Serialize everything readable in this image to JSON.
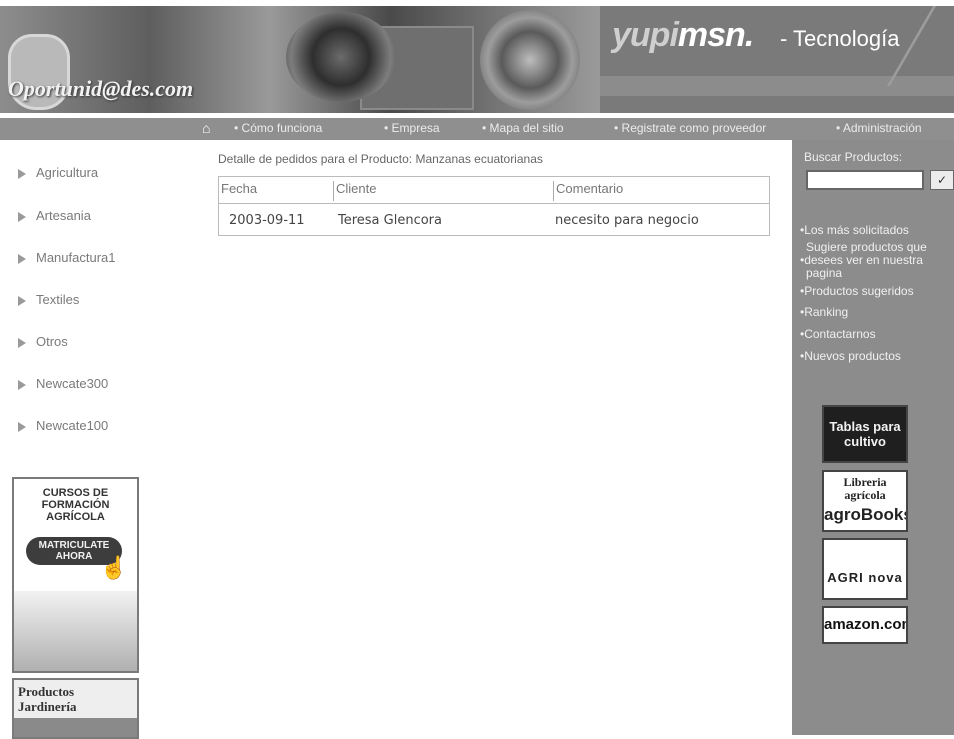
{
  "header": {
    "logo_text": "Oportunid@des.com",
    "msn_brand_light": "yupi",
    "msn_brand_bold": "msn.",
    "msn_suffix": "- Tecnología"
  },
  "nav": {
    "items": [
      "• Cómo funciona",
      "• Empresa",
      "• Mapa del sitio",
      "• Registrate como proveedor",
      "• Administración"
    ]
  },
  "sidebar": {
    "categories": [
      "Agricultura",
      "Artesania",
      "Manufactura1",
      "Textiles",
      "Otros",
      "Newcate300",
      "Newcate100"
    ],
    "ad_cursos": {
      "title": "CURSOS DE FORMACIÓN AGRÍCOLA",
      "button": "MATRICULATE AHORA"
    },
    "ad_productos": {
      "line1": "Productos",
      "line2": "Jardinería"
    }
  },
  "main": {
    "title": "Detalle de pedidos para el Producto: Manzanas ecuatorianas",
    "columns": [
      "Fecha",
      "Cliente",
      "Comentario"
    ],
    "rows": [
      {
        "fecha": "2003-09-11",
        "cliente": "Teresa Glencora",
        "comentario": "necesito para negocio"
      }
    ]
  },
  "right": {
    "search_label": "Buscar Productos:",
    "search_value": "",
    "search_button": "✓",
    "links": {
      "mas_solicitados": "•Los más solicitados",
      "sugiere_1": "Sugiere productos que",
      "sugiere_2": "•desees ver en nuestra",
      "sugiere_3": "pagina",
      "sugeridos": "•Productos sugeridos",
      "ranking": "•Ranking",
      "contactarnos": "•Contactarnos",
      "nuevos": "•Nuevos productos"
    },
    "logos": {
      "tablas": "Tablas para cultivo",
      "libreria": "Libreria agrícola",
      "libreria_sub": "agroBooks",
      "agrinova": "AGRI nova",
      "amazon": "amazon.com"
    }
  }
}
